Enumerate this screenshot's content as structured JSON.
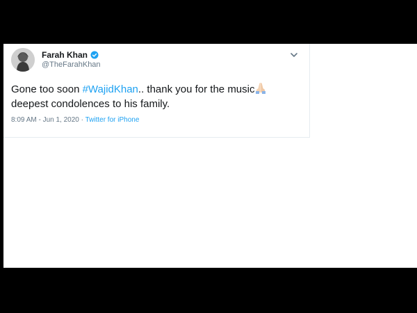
{
  "tweet": {
    "author_name": "Farah Khan",
    "handle": "@TheFarahKhan",
    "text_before_hashtag": "Gone too soon ",
    "hashtag": "#WajidKhan",
    "text_after_hashtag": ".. thank you for the music",
    "emoji": "folded-hands",
    "text_line2": "deepest condolences to his family.",
    "time": "8:09 AM",
    "separator": " - ",
    "date": "Jun 1, 2020",
    "separator2": " · ",
    "source": "Twitter for iPhone"
  },
  "icons": {
    "verified": "verified-badge-icon",
    "more": "chevron-down-icon"
  },
  "colors": {
    "accent": "#1da1f2",
    "text": "#14171a",
    "muted": "#657786",
    "border": "#e6ecf0",
    "backdrop": "#000000"
  }
}
